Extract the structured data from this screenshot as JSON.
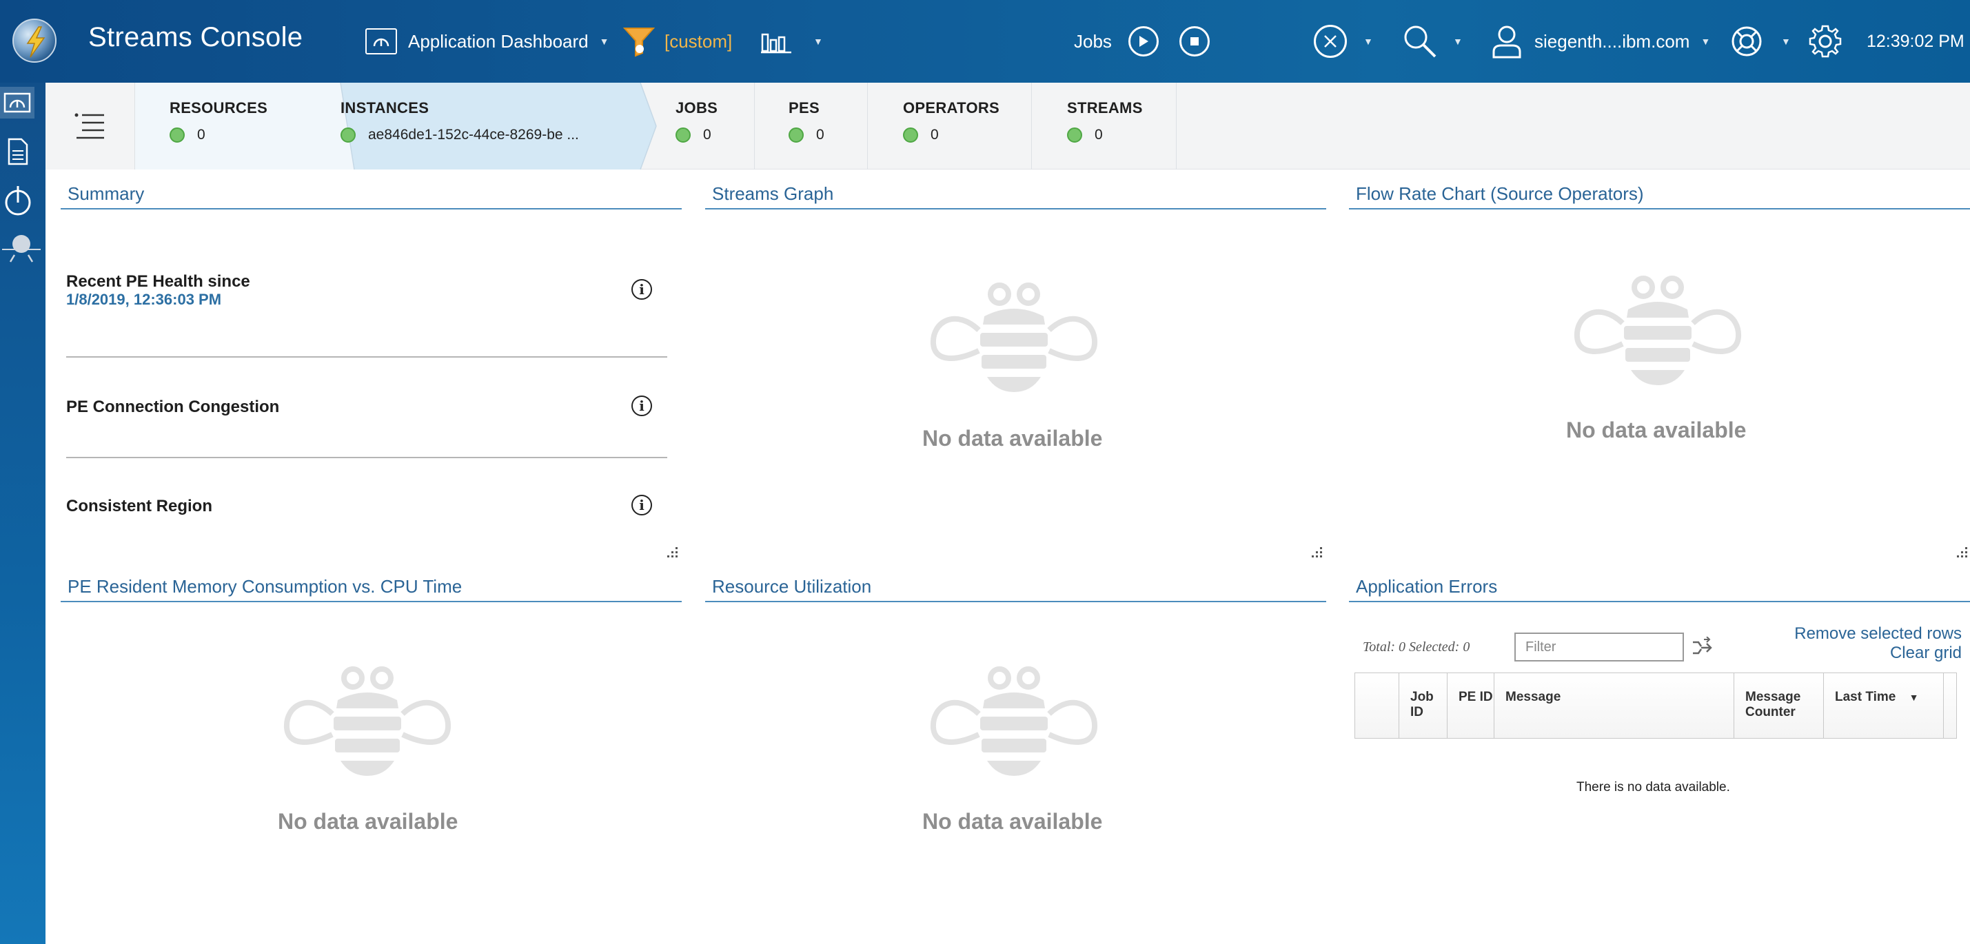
{
  "app": {
    "title": "Streams Console"
  },
  "header": {
    "dashboard_label": "Application Dashboard",
    "filter_label": "[custom]",
    "jobs_label": "Jobs",
    "user": "siegenth....ibm.com",
    "time": "12:39:02 PM"
  },
  "breadcrumbs": [
    {
      "title": "RESOURCES",
      "value": "0"
    },
    {
      "title": "INSTANCES",
      "value": "ae846de1-152c-44ce-8269-be ..."
    },
    {
      "title": "JOBS",
      "value": "0"
    },
    {
      "title": "PES",
      "value": "0"
    },
    {
      "title": "OPERATORS",
      "value": "0"
    },
    {
      "title": "STREAMS",
      "value": "0"
    }
  ],
  "panels": {
    "summary": {
      "title": "Summary",
      "health_label": "Recent PE Health since",
      "health_since": "1/8/2019, 12:36:03 PM",
      "congestion_label": "PE Connection Congestion",
      "region_label": "Consistent Region"
    },
    "streams_graph": {
      "title": "Streams Graph",
      "empty": "No data available"
    },
    "flow_rate": {
      "title": "Flow Rate Chart (Source Operators)",
      "empty": "No data available"
    },
    "memory": {
      "title": "PE Resident Memory Consumption vs. CPU Time",
      "empty": "No data available"
    },
    "resource_util": {
      "title": "Resource Utilization",
      "empty": "No data available"
    },
    "app_errors": {
      "title": "Application Errors",
      "totals": "Total: 0 Selected: 0",
      "filter_placeholder": "Filter",
      "remove_selected": "Remove selected rows",
      "clear_grid": "Clear grid",
      "columns": [
        "Job ID",
        "PE ID",
        "Message",
        "Message Counter",
        "Last Time"
      ],
      "empty": "There is no data available."
    }
  },
  "colors": {
    "header_bg": "#105b97",
    "accent": "#2a6496",
    "status_ok": "#78c56b",
    "filter_custom": "#f2b64a"
  }
}
